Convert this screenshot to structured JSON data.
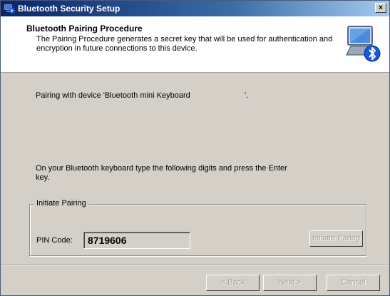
{
  "window": {
    "title": "Bluetooth Security Setup",
    "close_label": "×",
    "title_icon": "bluetooth-computer-icon"
  },
  "header": {
    "title": "Bluetooth Pairing Procedure",
    "description": "The Pairing Procedure generates a secret key that will be used for authentication and encryption in future connections to this device.",
    "icon": "bluetooth-computer-icon"
  },
  "content": {
    "pairing_message": "Pairing with device 'Bluetooth mini Keyboard                         '.",
    "instruction": "On your Bluetooth keyboard type the following digits and press the Enter key."
  },
  "pairing_group": {
    "legend": "Initiate Pairing",
    "pin_label": "PIN Code:",
    "pin_value": "8719606",
    "initiate_button": "Initiate Paring"
  },
  "footer": {
    "back_label": "< Back",
    "next_label": "Next >",
    "cancel_label": "Cancel"
  },
  "colors": {
    "titlebar_start": "#0a246a",
    "dialog_bg": "#d4d0c8",
    "header_bg": "#ffffff",
    "disabled_text": "#a0a0a0"
  }
}
